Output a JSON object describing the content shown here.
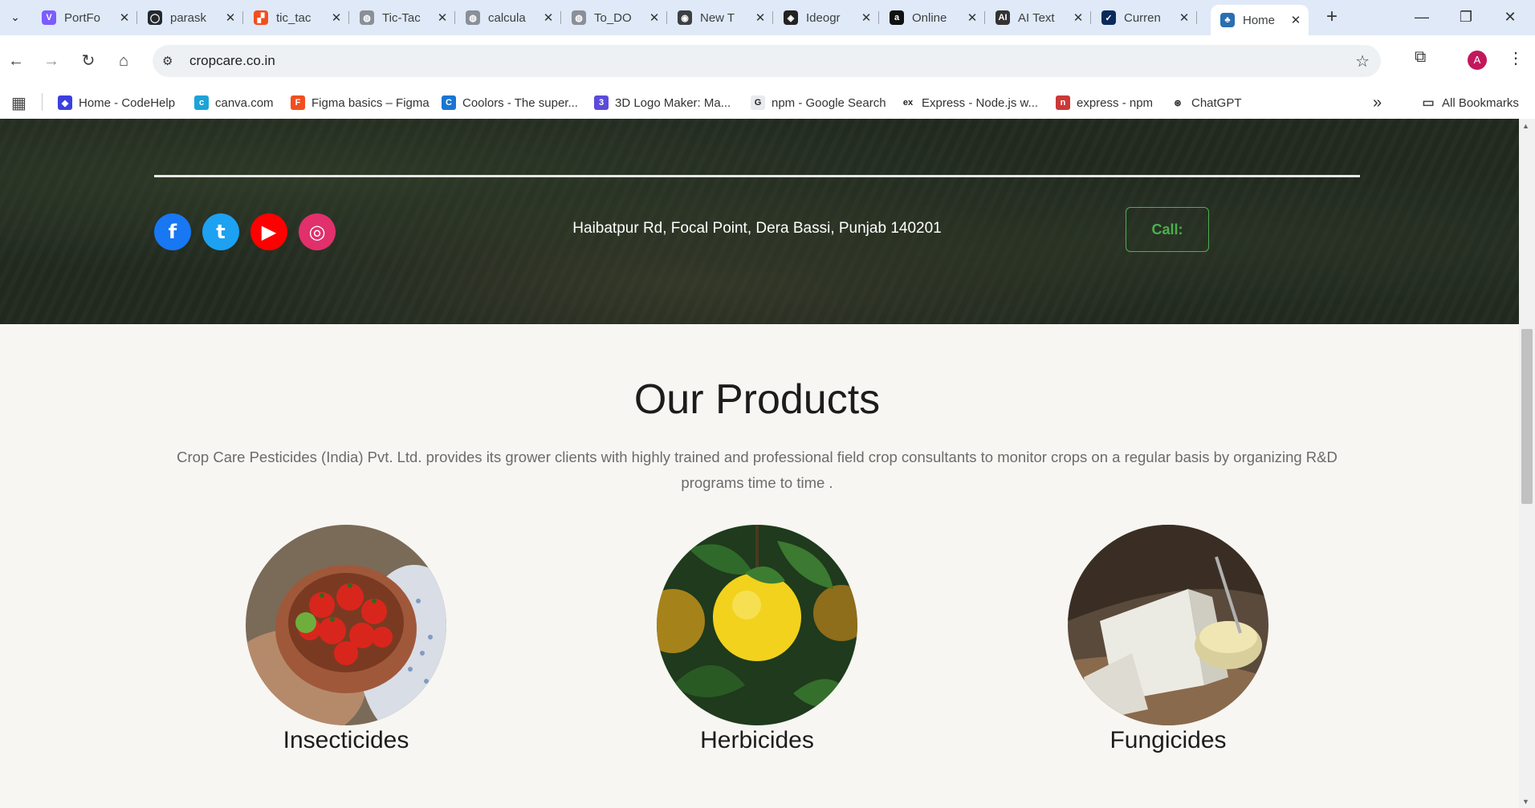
{
  "browser": {
    "tabs": [
      {
        "title": "PortFo",
        "icon": "v-logo-icon",
        "color": "#7b5cff",
        "glyph": "V"
      },
      {
        "title": "parask",
        "icon": "github-icon",
        "color": "#24292f",
        "glyph": "◯"
      },
      {
        "title": "tic_tac",
        "icon": "figma-doc-icon",
        "color": "#f24e1e",
        "glyph": "▞"
      },
      {
        "title": "Tic-Tac",
        "icon": "globe-icon",
        "color": "#8a8f98",
        "glyph": "◍"
      },
      {
        "title": "calcula",
        "icon": "globe-icon",
        "color": "#8a8f98",
        "glyph": "◍"
      },
      {
        "title": "To_DO",
        "icon": "globe-icon",
        "color": "#8a8f98",
        "glyph": "◍"
      },
      {
        "title": "New T",
        "icon": "chrome-icon",
        "color": "#3c4043",
        "glyph": "◉"
      },
      {
        "title": "Ideogr",
        "icon": "ideogram-icon",
        "color": "#222",
        "glyph": "◈"
      },
      {
        "title": "Online",
        "icon": "amazon-icon",
        "color": "#111",
        "glyph": "a"
      },
      {
        "title": "AI Text",
        "icon": "ai-icon",
        "color": "#333",
        "glyph": "AI"
      },
      {
        "title": "Curren",
        "icon": "chart-app-icon",
        "color": "#0b2a5b",
        "glyph": "✓"
      },
      {
        "title": "Home",
        "icon": "cropcare-icon",
        "color": "#2a6fb0",
        "glyph": "♣",
        "active": true
      }
    ],
    "url": "cropcare.co.in",
    "avatar_letter": "A",
    "bookmarks": [
      {
        "label": "Home - CodeHelp",
        "color": "#3b3fe0",
        "glyph": "◆"
      },
      {
        "label": "canva.com",
        "color": "#1ca3d8",
        "glyph": "c"
      },
      {
        "label": "Figma basics – Figma",
        "color": "#f24e1e",
        "glyph": "F"
      },
      {
        "label": "Coolors - The super...",
        "color": "#1976d2",
        "glyph": "C"
      },
      {
        "label": "3D Logo Maker: Ma...",
        "color": "#5b4bd8",
        "glyph": "3"
      },
      {
        "label": "npm - Google Search",
        "color": "#e8eaed",
        "glyph": "G"
      },
      {
        "label": "Express - Node.js w...",
        "color": "#ffffff",
        "glyph": "ex"
      },
      {
        "label": "express - npm",
        "color": "#cb3837",
        "glyph": "n"
      },
      {
        "label": "ChatGPT",
        "color": "#ffffff",
        "glyph": "⊛"
      }
    ],
    "all_bookmarks": "All Bookmarks",
    "more_bookmarks": "»"
  },
  "hero": {
    "address": "Haibatpur Rd, Focal Point, Dera Bassi, Punjab 140201",
    "call_label": "Call:",
    "socials": [
      {
        "name": "facebook",
        "color": "#1877f2",
        "glyph": "f"
      },
      {
        "name": "twitter",
        "color": "#1da1f2",
        "glyph": "t"
      },
      {
        "name": "youtube",
        "color": "#ff0000",
        "glyph": "▶"
      },
      {
        "name": "instagram",
        "color": "#e1306c",
        "glyph": "◎"
      }
    ]
  },
  "products": {
    "title": "Our Products",
    "description": "Crop Care Pesticides (India) Pvt. Ltd. provides its grower clients with highly trained and professional field crop consultants to monitor crops on a regular basis by organizing R&D programs time to time .",
    "items": [
      {
        "name": "Insecticides"
      },
      {
        "name": "Herbicides"
      },
      {
        "name": "Fungicides"
      }
    ]
  }
}
